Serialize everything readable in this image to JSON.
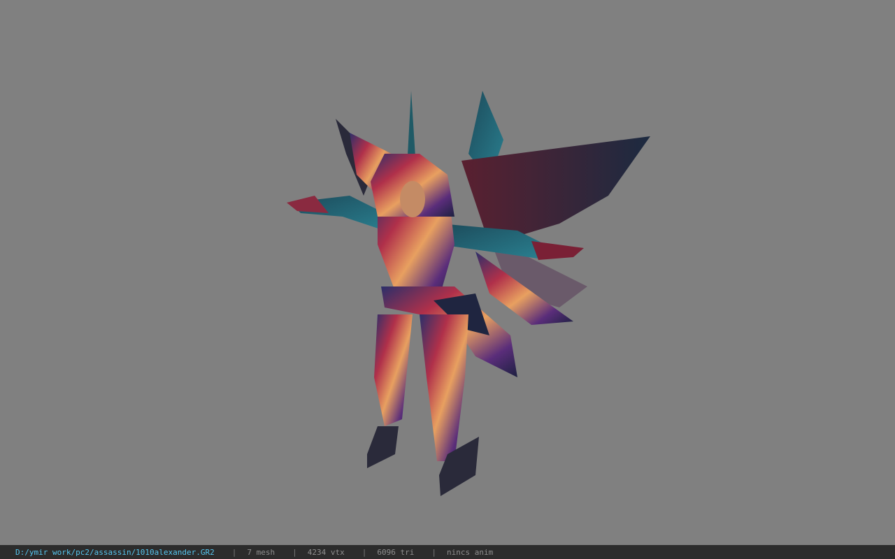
{
  "viewport": {
    "background_color": "#808080",
    "model_name": "3d-character-model"
  },
  "statusbar": {
    "file_path": "D:/ymir work/pc2/assassin/1010alexander.GR2",
    "separator": "|",
    "mesh_count": "7 mesh",
    "vertex_count": "4234 vtx",
    "triangle_count": "6096 tri",
    "anim_status": "nincs anim",
    "path_color": "#56c6f0",
    "text_color": "#8f8f8f"
  }
}
